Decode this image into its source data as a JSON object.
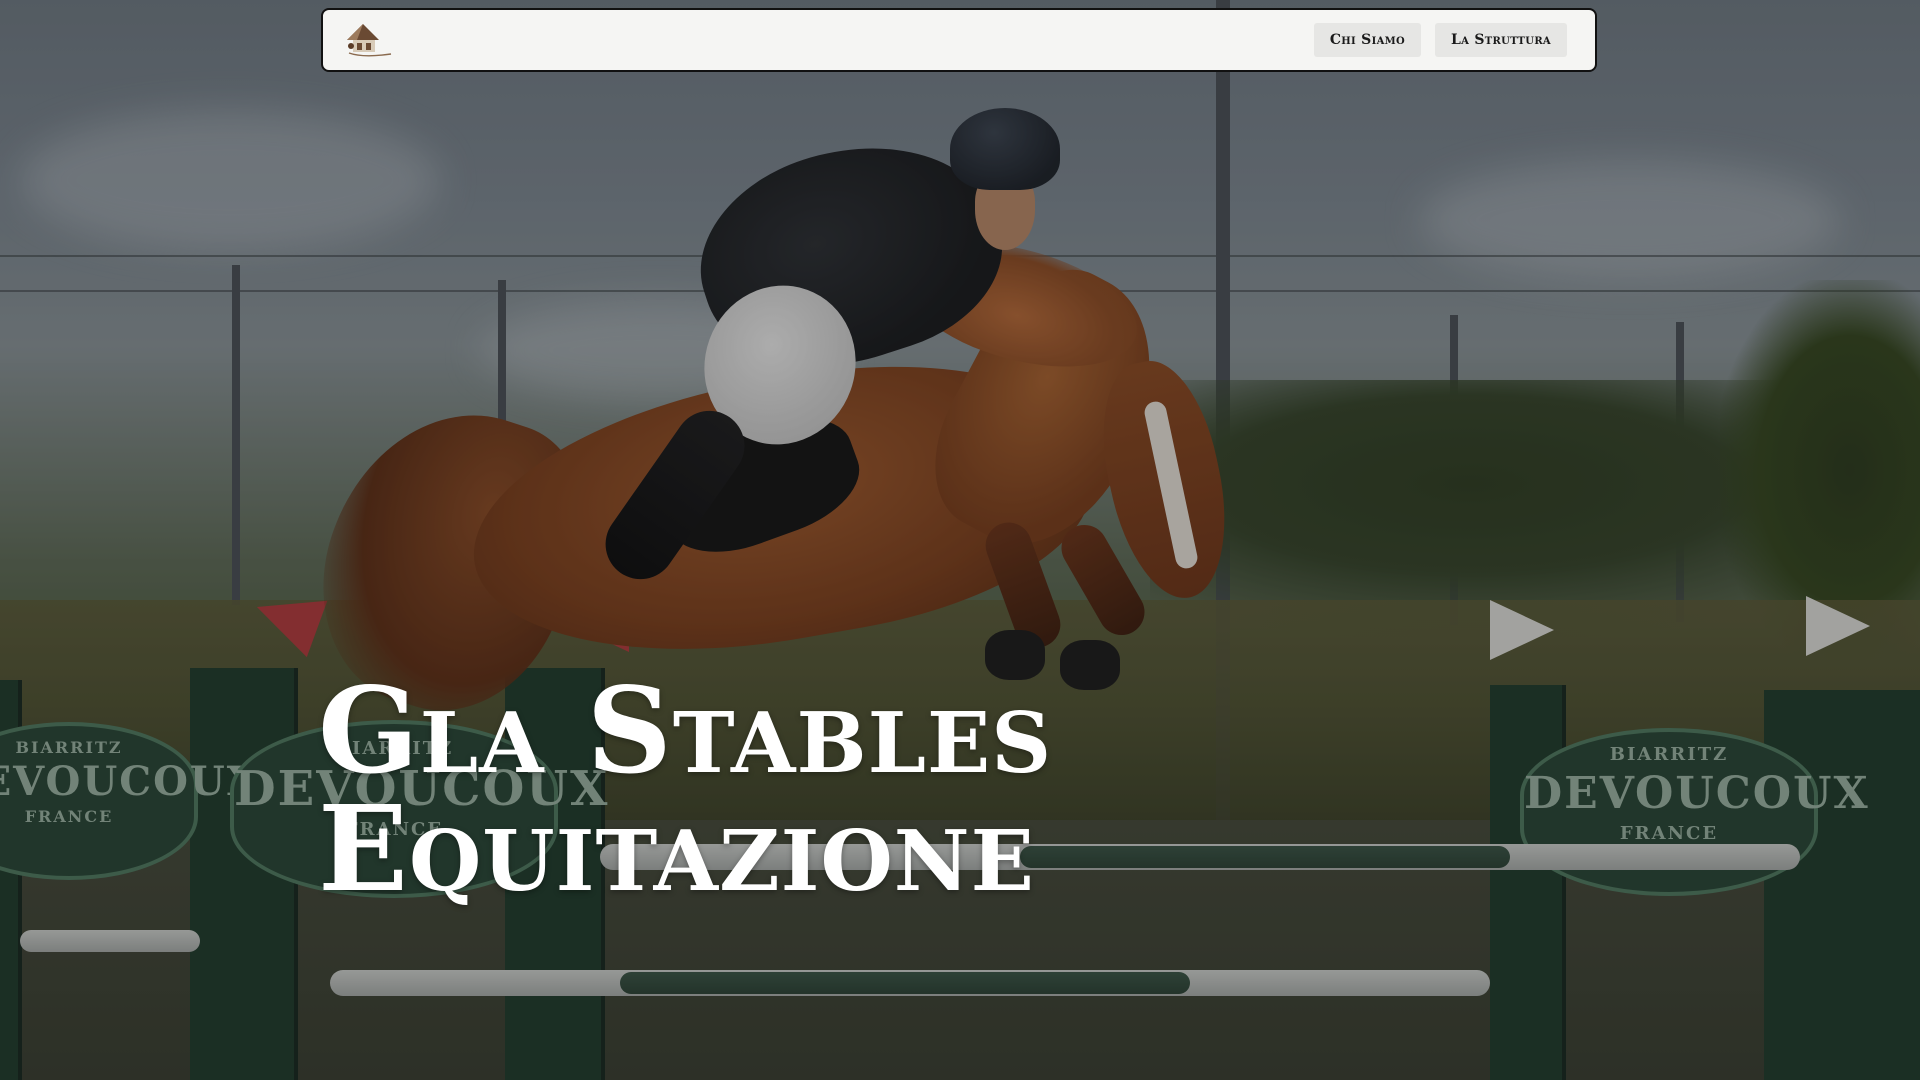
{
  "navbar": {
    "logo_icon": "stable-house-logo-icon",
    "links": [
      {
        "label": "Chi Siamo"
      },
      {
        "label": "La Struttura"
      }
    ]
  },
  "hero": {
    "title_line1": "Gla Stables",
    "title_line2": "Equitazione",
    "background_image": "show-jumping-horse-and-rider-photo"
  },
  "signs": {
    "brand": "DEVOUCOUX",
    "top": "BIARRITZ",
    "bottom": "FRANCE"
  },
  "colors": {
    "nav_background": "#f5f5f3",
    "nav_border": "#111111",
    "nav_button": "#e6e6e4",
    "title_text": "#ffffff",
    "overlay": "rgba(20,20,20,0.30)"
  }
}
